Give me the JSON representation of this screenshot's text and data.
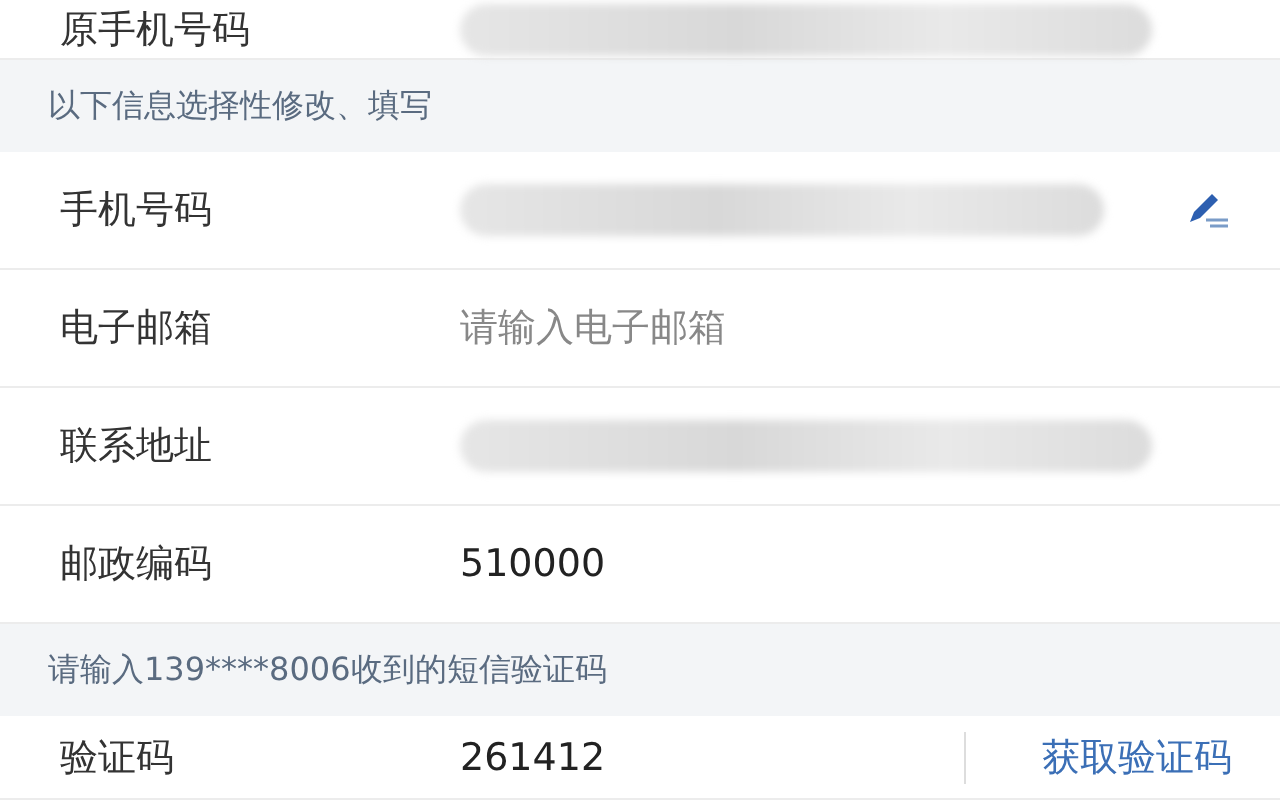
{
  "top_row": {
    "label": "原手机号码",
    "value": {
      "kind": "blurred"
    }
  },
  "sections": [
    {
      "header": "以下信息选择性修改、填写",
      "rows": [
        {
          "label": "手机号码",
          "value": {
            "kind": "blurred"
          },
          "editable": true
        },
        {
          "label": "电子邮箱",
          "value": {
            "kind": "input",
            "placeholder": "请输入电子邮箱"
          },
          "editable": false
        },
        {
          "label": "联系地址",
          "value": {
            "kind": "blurred"
          },
          "editable": false
        },
        {
          "label": "邮政编码",
          "value": {
            "kind": "text",
            "text": "510000"
          },
          "editable": false
        }
      ]
    },
    {
      "header": "请输入139****8006收到的短信验证码",
      "rows": [
        {
          "label": "验证码",
          "value": {
            "kind": "text",
            "text": "261412"
          },
          "editable": false,
          "action": "获取验证码"
        }
      ]
    }
  ]
}
